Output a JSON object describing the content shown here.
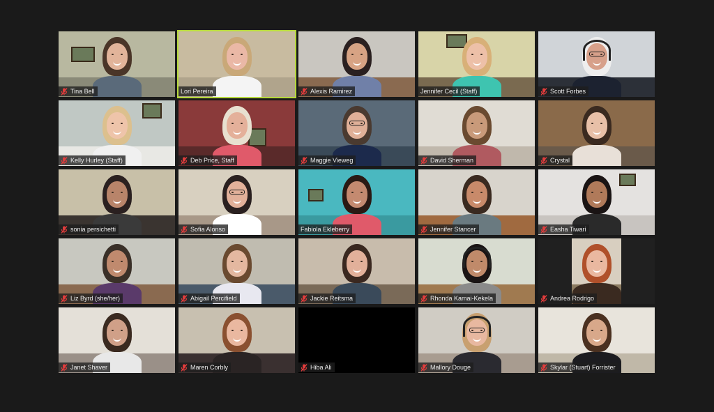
{
  "app": "Zoom Meeting - Gallery View",
  "colors": {
    "background": "#1a1a1a",
    "active_speaker_border": "#b6d93c",
    "mute_icon": "#e03c3c",
    "nametag_bg": "rgba(30,30,30,0.78)",
    "nametag_text": "#ececec"
  },
  "participants": [
    {
      "name": "Tina Bell",
      "muted": true,
      "active_speaker": false,
      "video": true
    },
    {
      "name": "Lori Pereira",
      "muted": false,
      "active_speaker": true,
      "video": true
    },
    {
      "name": "Alexis Ramirez",
      "muted": true,
      "active_speaker": false,
      "video": true
    },
    {
      "name": "Jennifer Cecil (Staff)",
      "muted": false,
      "active_speaker": false,
      "video": true
    },
    {
      "name": "Scott Forbes",
      "muted": true,
      "active_speaker": false,
      "video": true
    },
    {
      "name": "Kelly Hurley (Staff)",
      "muted": true,
      "active_speaker": false,
      "video": true
    },
    {
      "name": "Deb Price, Staff",
      "muted": true,
      "active_speaker": false,
      "video": true
    },
    {
      "name": "Maggie Vieweg",
      "muted": true,
      "active_speaker": false,
      "video": true
    },
    {
      "name": "David Sherman",
      "muted": true,
      "active_speaker": false,
      "video": true
    },
    {
      "name": "Crystal",
      "muted": true,
      "active_speaker": false,
      "video": true
    },
    {
      "name": "sonia persichetti",
      "muted": true,
      "active_speaker": false,
      "video": true
    },
    {
      "name": "Sofia Alonso",
      "muted": true,
      "active_speaker": false,
      "video": true
    },
    {
      "name": "Fabiola Ekleberry",
      "muted": false,
      "active_speaker": false,
      "video": true
    },
    {
      "name": "Jennifer Stancer",
      "muted": true,
      "active_speaker": false,
      "video": true
    },
    {
      "name": "Easha Tiwari",
      "muted": true,
      "active_speaker": false,
      "video": true
    },
    {
      "name": "Liz Byrd (she/her)",
      "muted": true,
      "active_speaker": false,
      "video": true
    },
    {
      "name": "Abigail Percifield",
      "muted": true,
      "active_speaker": false,
      "video": true
    },
    {
      "name": "Jackie Reitsma",
      "muted": true,
      "active_speaker": false,
      "video": true
    },
    {
      "name": "Rhonda Kamai-Kekela",
      "muted": true,
      "active_speaker": false,
      "video": true
    },
    {
      "name": "Andrea Rodrigo",
      "muted": true,
      "active_speaker": false,
      "video": true
    },
    {
      "name": "Janet Shaver",
      "muted": true,
      "active_speaker": false,
      "video": true
    },
    {
      "name": "Maren Corbly",
      "muted": true,
      "active_speaker": false,
      "video": true
    },
    {
      "name": "Hiba Ali",
      "muted": true,
      "active_speaker": false,
      "video": false
    },
    {
      "name": "Mallory Douge",
      "muted": true,
      "active_speaker": false,
      "video": true
    },
    {
      "name": "Skylar (Stuart) Forrister",
      "muted": true,
      "active_speaker": false,
      "video": true
    }
  ]
}
